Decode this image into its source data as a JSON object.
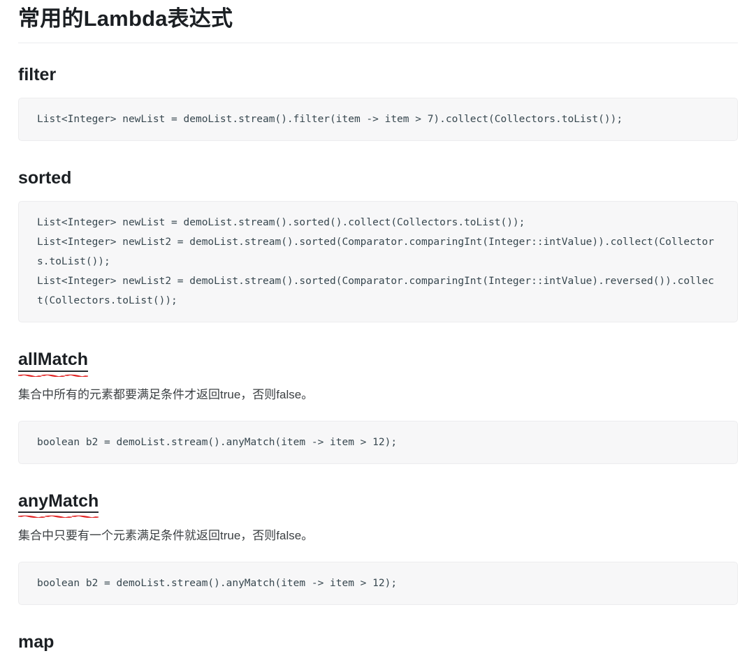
{
  "document": {
    "title": "常用的Lambda表达式"
  },
  "sections": [
    {
      "heading": "filter",
      "underlined": false,
      "description": null,
      "code": "List<Integer> newList = demoList.stream().filter(item -> item > 7).collect(Collectors.toList());"
    },
    {
      "heading": "sorted",
      "underlined": false,
      "description": null,
      "code": "List<Integer> newList = demoList.stream().sorted().collect(Collectors.toList());\nList<Integer> newList2 = demoList.stream().sorted(Comparator.comparingInt(Integer::intValue)).collect(Collectors.toList());\nList<Integer> newList2 = demoList.stream().sorted(Comparator.comparingInt(Integer::intValue).reversed()).collect(Collectors.toList());"
    },
    {
      "heading": "allMatch",
      "underlined": true,
      "description": "集合中所有的元素都要满足条件才返回true，否则false。",
      "code": "boolean b2 = demoList.stream().anyMatch(item -> item > 12);"
    },
    {
      "heading": "anyMatch",
      "underlined": true,
      "description": "集合中只要有一个元素满足条件就返回true，否则false。",
      "code": "boolean b2 = demoList.stream().anyMatch(item -> item > 12);"
    },
    {
      "heading": "map",
      "underlined": false,
      "description": null,
      "code": null
    }
  ],
  "colors": {
    "text": "#24292e",
    "code_text": "#37474f",
    "code_bg": "#f7f7f8",
    "rule": "#eaecef",
    "spellcheck": "#e02020"
  }
}
